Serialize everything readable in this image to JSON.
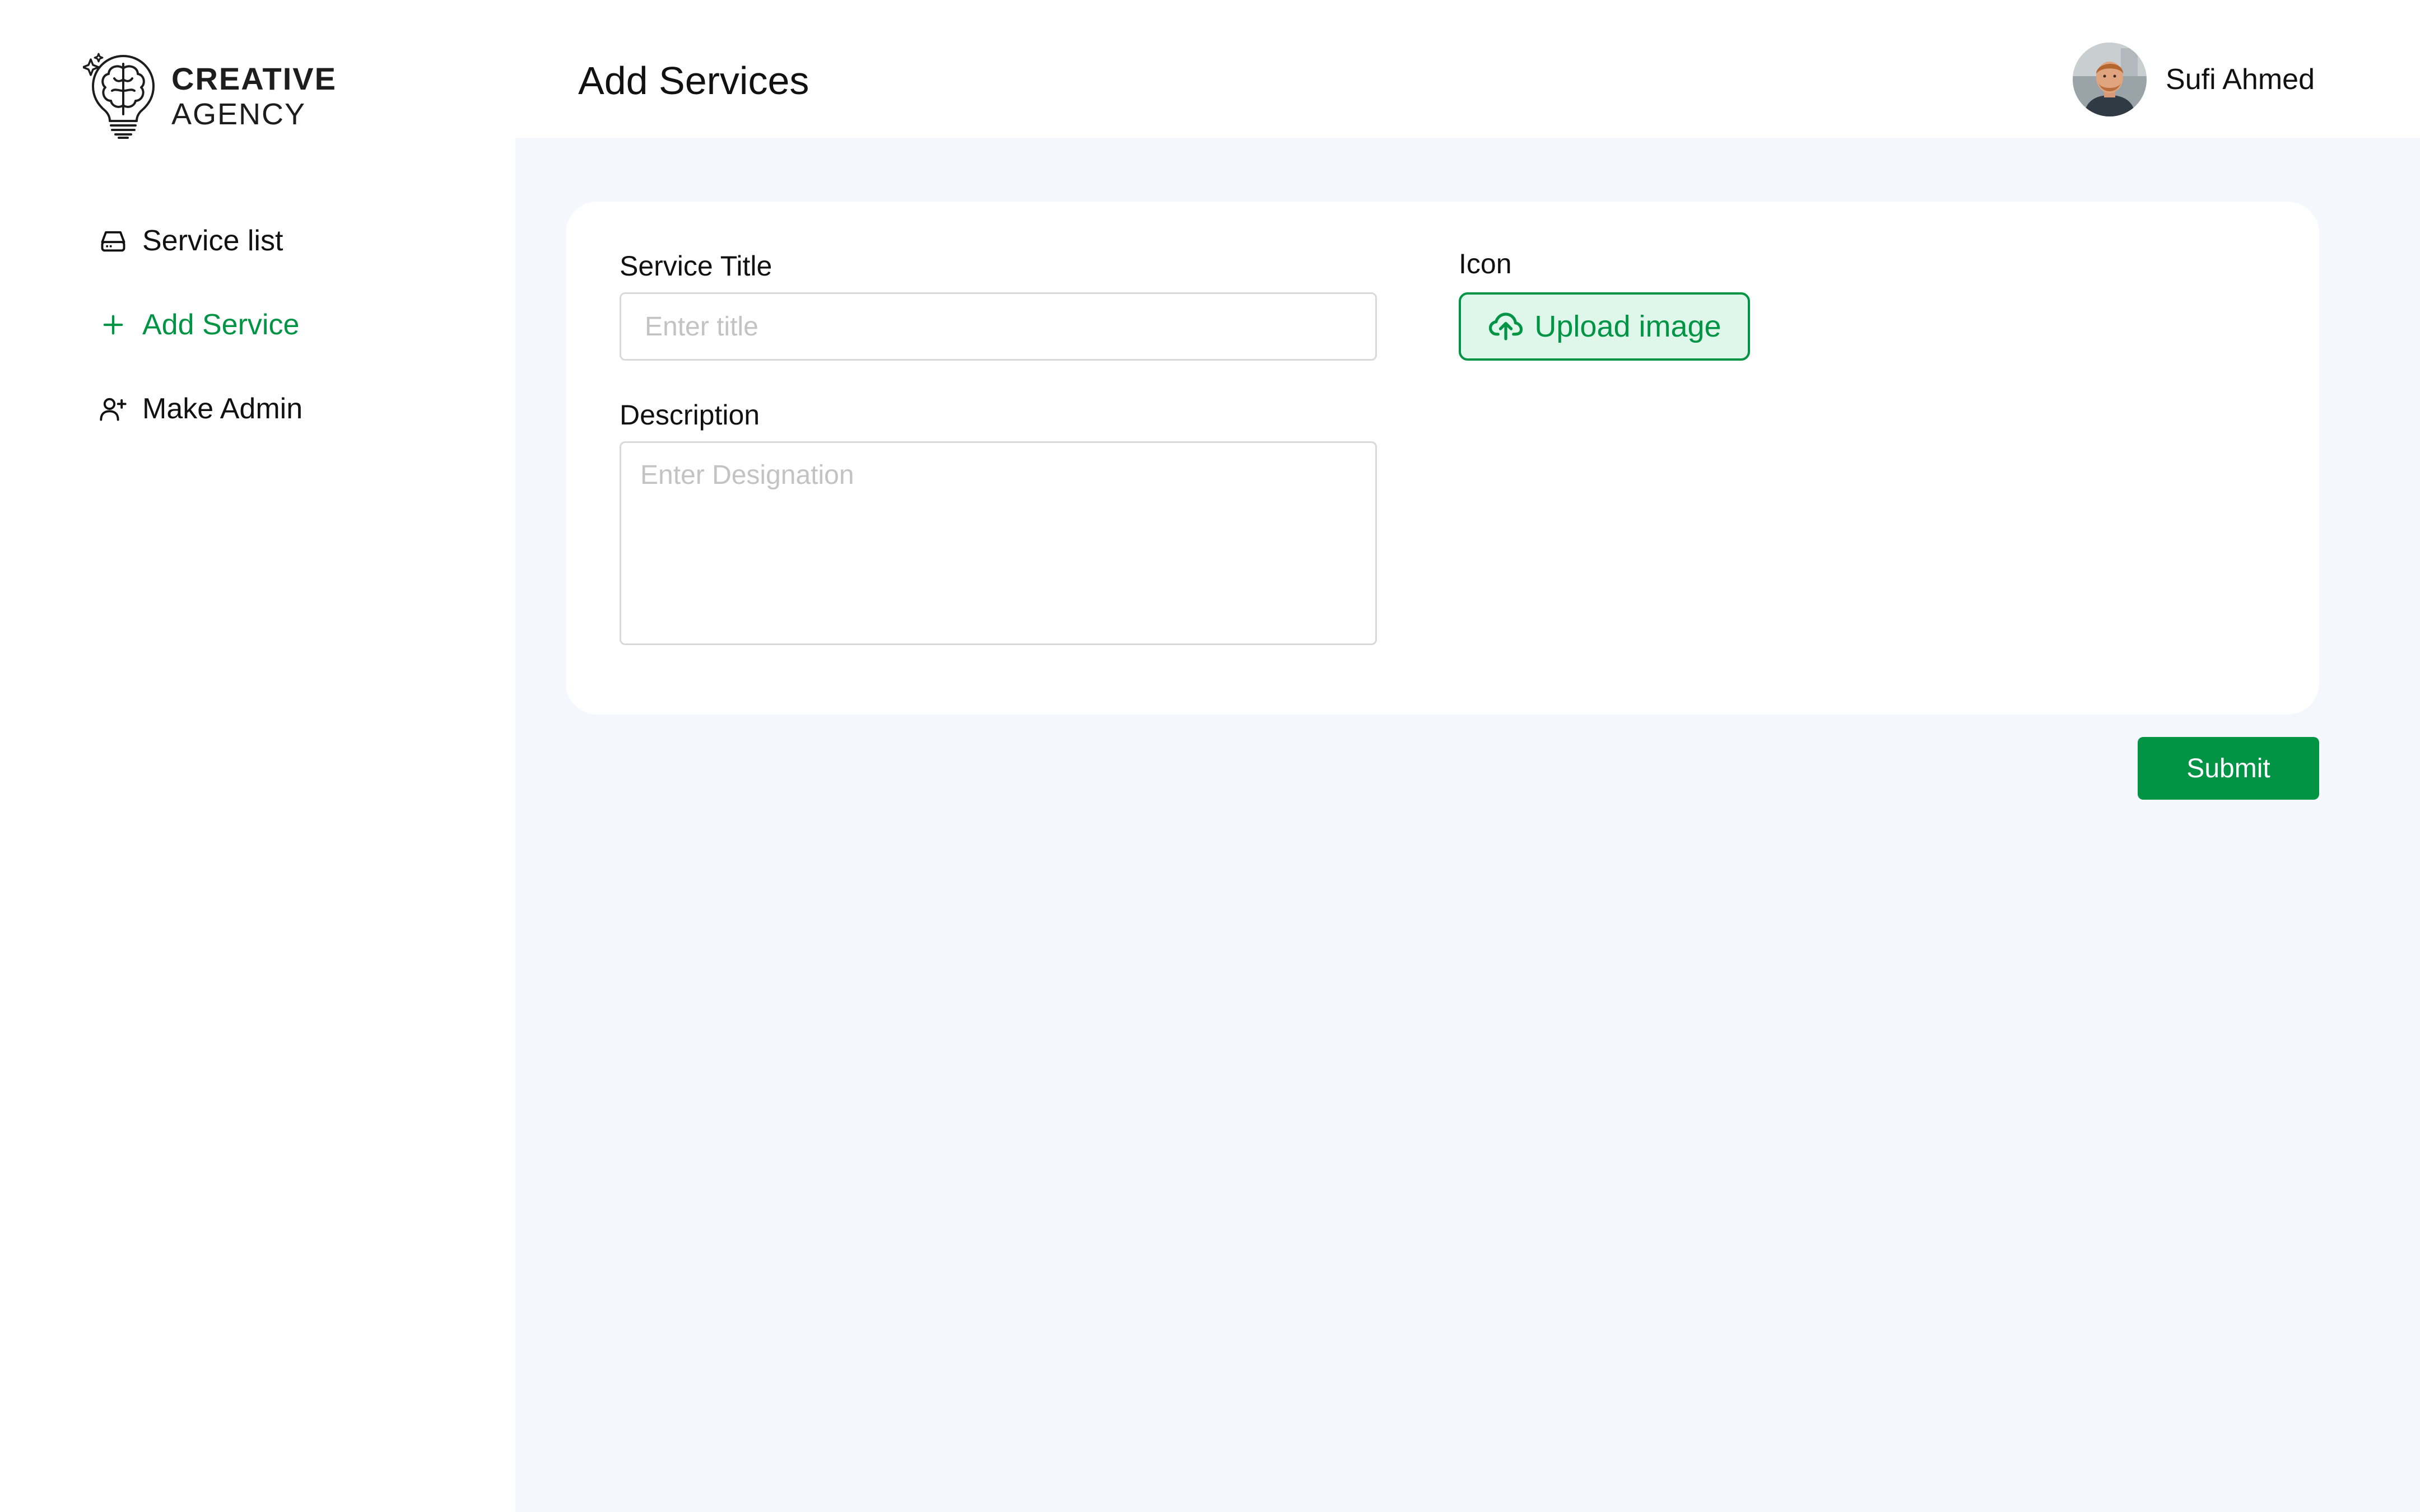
{
  "brand": {
    "line1": "CREATIVE",
    "line2": "AGENCY",
    "logo_icon": "lightbulb-brain-icon"
  },
  "sidebar": {
    "items": [
      {
        "label": "Service list",
        "icon": "hard-drive-icon",
        "active": false
      },
      {
        "label": "Add Service",
        "icon": "plus-icon",
        "active": true
      },
      {
        "label": "Make Admin",
        "icon": "user-plus-icon",
        "active": false
      }
    ]
  },
  "header": {
    "title": "Add Services",
    "user": {
      "name": "Sufi Ahmed"
    }
  },
  "form": {
    "service_title": {
      "label": "Service Title",
      "placeholder": "Enter title",
      "value": ""
    },
    "description": {
      "label": "Description",
      "placeholder": "Enter Designation",
      "value": ""
    },
    "icon": {
      "label": "Icon",
      "upload_label": "Upload image"
    },
    "submit_label": "Submit"
  },
  "colors": {
    "accent": "#009444",
    "accent_light": "#def7ea",
    "main_bg": "#f4f7fc",
    "card_bg": "#ffffff",
    "border": "#d9d9d9",
    "placeholder": "#c3c3c3",
    "text": "#111111"
  }
}
